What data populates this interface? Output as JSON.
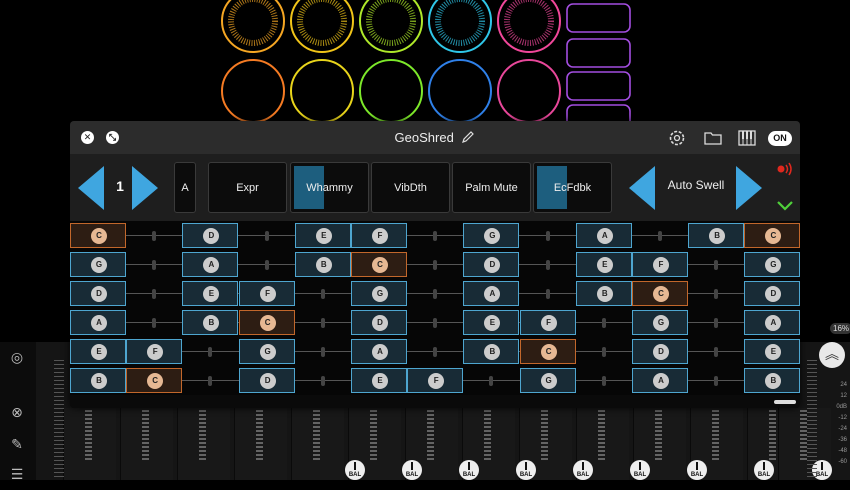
{
  "pads": {
    "colors": [
      "#f5a623",
      "#f0c419",
      "#aee82a",
      "#2fc6e8",
      "#f0479a",
      "#a34ee0"
    ],
    "row2_colors": [
      "#f57b23",
      "#e8d41b",
      "#7de82a",
      "#2f80e8",
      "#e8479a"
    ]
  },
  "plugin": {
    "title": "GeoShred",
    "on_label": "ON",
    "close_icon": "close-icon",
    "resize_icon": "resize-icon",
    "pencil_icon": "pencil-icon",
    "gear_icon": "gear-icon",
    "folder_icon": "folder-icon",
    "piano_icon": "piano-icon"
  },
  "controls": {
    "preset_number": "1",
    "key_label": "A",
    "buttons": [
      {
        "label": "Expr",
        "active": false
      },
      {
        "label": "Whammy",
        "active": true
      },
      {
        "label": "VibDth",
        "active": false
      },
      {
        "label": "Palm Mute",
        "active": false
      },
      {
        "label": "EcFdbk",
        "active": true
      }
    ],
    "auto_label": "Auto Swell"
  },
  "fretboard": {
    "rows": [
      [
        "C",
        "",
        "D",
        "",
        "E",
        "F",
        "",
        "G",
        "",
        "A",
        "",
        "B",
        "C"
      ],
      [
        "G",
        "",
        "A",
        "",
        "B",
        "C",
        "",
        "D",
        "",
        "E",
        "F",
        "",
        "G"
      ],
      [
        "D",
        "",
        "E",
        "F",
        "",
        "G",
        "",
        "A",
        "",
        "B",
        "C",
        "",
        "D"
      ],
      [
        "A",
        "",
        "B",
        "C",
        "",
        "D",
        "",
        "E",
        "F",
        "",
        "G",
        "",
        "A"
      ],
      [
        "E",
        "F",
        "",
        "G",
        "",
        "A",
        "",
        "B",
        "C",
        "",
        "D",
        "",
        "E"
      ],
      [
        "B",
        "C",
        "",
        "D",
        "",
        "E",
        "F",
        "",
        "G",
        "",
        "A",
        "",
        "B"
      ]
    ],
    "root_note": "C"
  },
  "host": {
    "percent": "16%",
    "db_scale": [
      "24",
      "12",
      "0dB",
      "-12",
      "-24",
      "-36",
      "-48",
      "-60"
    ],
    "bal_label": "BAL"
  }
}
